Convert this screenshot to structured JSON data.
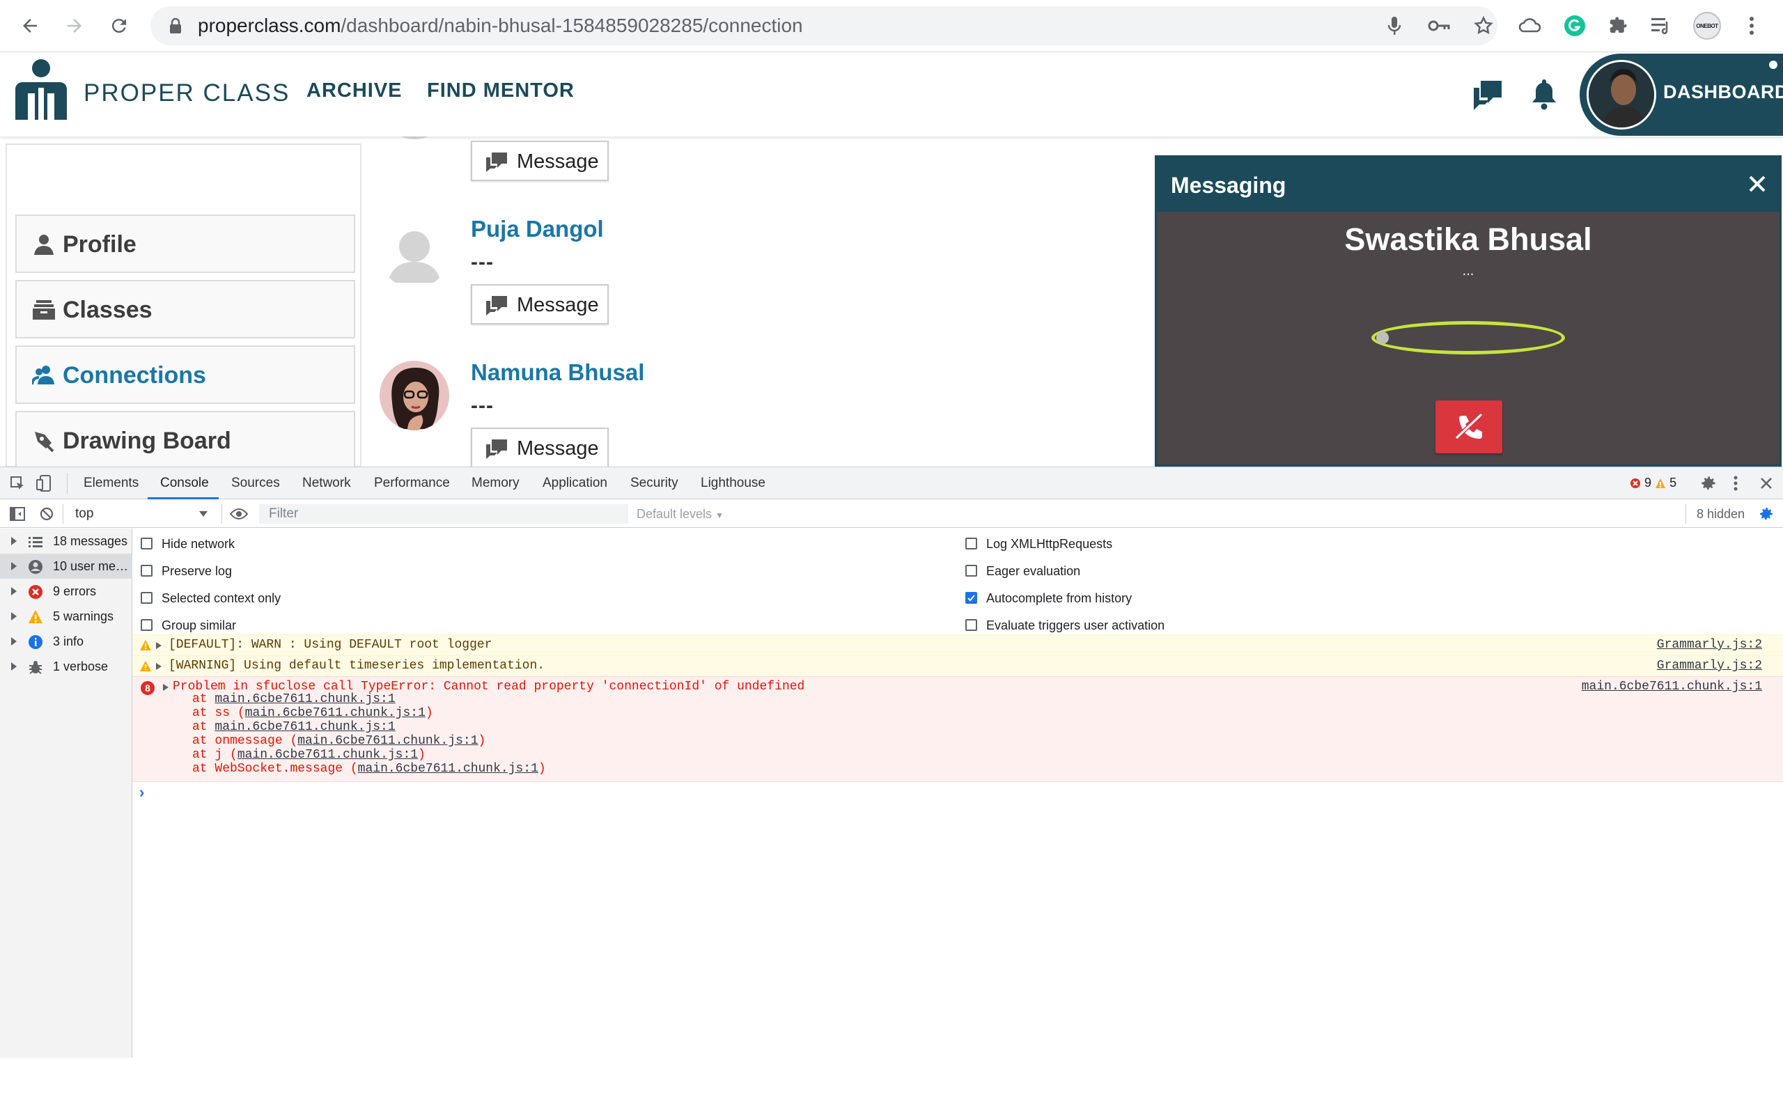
{
  "browser": {
    "url_host": "properclass.com",
    "url_path": "/dashboard/nabin-bhusal-1584859028285/connection",
    "profile_badge": "ONEBOT"
  },
  "site": {
    "brand": "PROPER CLASS",
    "nav": [
      "ARCHIVE",
      "FIND MENTOR"
    ],
    "dashboard_label": "DASHBOARD"
  },
  "sidebar": {
    "items": [
      {
        "label": "Profile",
        "icon": "person-icon"
      },
      {
        "label": "Classes",
        "icon": "archive-box-icon"
      },
      {
        "label": "Connections",
        "icon": "people-icon",
        "active": true
      },
      {
        "label": "Drawing Board",
        "icon": "pen-nib-icon"
      }
    ]
  },
  "connections": {
    "message_label": "Message",
    "items": [
      {
        "name": "Puja Dangol",
        "subtitle": "---"
      },
      {
        "name": "Namuna Bhusal",
        "subtitle": "---"
      }
    ]
  },
  "messaging": {
    "title": "Messaging",
    "caller": "Swastika Bhusal",
    "status": "..."
  },
  "devtools": {
    "tabs": [
      "Elements",
      "Console",
      "Sources",
      "Network",
      "Performance",
      "Memory",
      "Application",
      "Security",
      "Lighthouse"
    ],
    "active_tab": "Console",
    "error_count": "9",
    "warning_count": "5",
    "context": "top",
    "filter_placeholder": "Filter",
    "levels": "Default levels",
    "hidden": "8 hidden",
    "sidebar": [
      {
        "label": "18 messages",
        "icon": "list-icon"
      },
      {
        "label": "10 user me…",
        "icon": "user-circle-icon"
      },
      {
        "label": "9 errors",
        "icon": "error-icon"
      },
      {
        "label": "5 warnings",
        "icon": "warning-icon"
      },
      {
        "label": "3 info",
        "icon": "info-icon"
      },
      {
        "label": "1 verbose",
        "icon": "bug-icon"
      }
    ],
    "settings_left": [
      {
        "label": "Hide network",
        "checked": false
      },
      {
        "label": "Preserve log",
        "checked": false
      },
      {
        "label": "Selected context only",
        "checked": false
      },
      {
        "label": "Group similar",
        "checked": false
      }
    ],
    "settings_right": [
      {
        "label": "Log XMLHttpRequests",
        "checked": false
      },
      {
        "label": "Eager evaluation",
        "checked": false
      },
      {
        "label": "Autocomplete from history",
        "checked": true
      },
      {
        "label": "Evaluate triggers user activation",
        "checked": false
      }
    ],
    "logs": [
      {
        "level": "warn",
        "text": "[DEFAULT]: WARN : Using DEFAULT root logger",
        "source": "Grammarly.js:2"
      },
      {
        "level": "warn",
        "text": "[WARNING] Using default timeseries implementation.",
        "source": "Grammarly.js:2"
      },
      {
        "level": "error",
        "count": "8",
        "text": "Problem in sfuclose call TypeError: Cannot read property 'connectionId' of undefined",
        "source": "main.6cbe7611.chunk.js:1"
      }
    ],
    "stack": [
      {
        "fn": "",
        "loc": "main.6cbe7611.chunk.js:1"
      },
      {
        "fn": "ss",
        "loc": "main.6cbe7611.chunk.js:1"
      },
      {
        "fn": "",
        "loc": "main.6cbe7611.chunk.js:1"
      },
      {
        "fn": "onmessage",
        "loc": "main.6cbe7611.chunk.js:1"
      },
      {
        "fn": "j",
        "loc": "main.6cbe7611.chunk.js:1"
      },
      {
        "fn": "WebSocket.message",
        "loc": "main.6cbe7611.chunk.js:1"
      }
    ],
    "stack_prefix": "at",
    "prompt": "›"
  },
  "colors": {
    "brand": "#1c4a5a",
    "link": "#1b76a8",
    "ring": "#c8e43a",
    "hangup": "#d9363e"
  }
}
